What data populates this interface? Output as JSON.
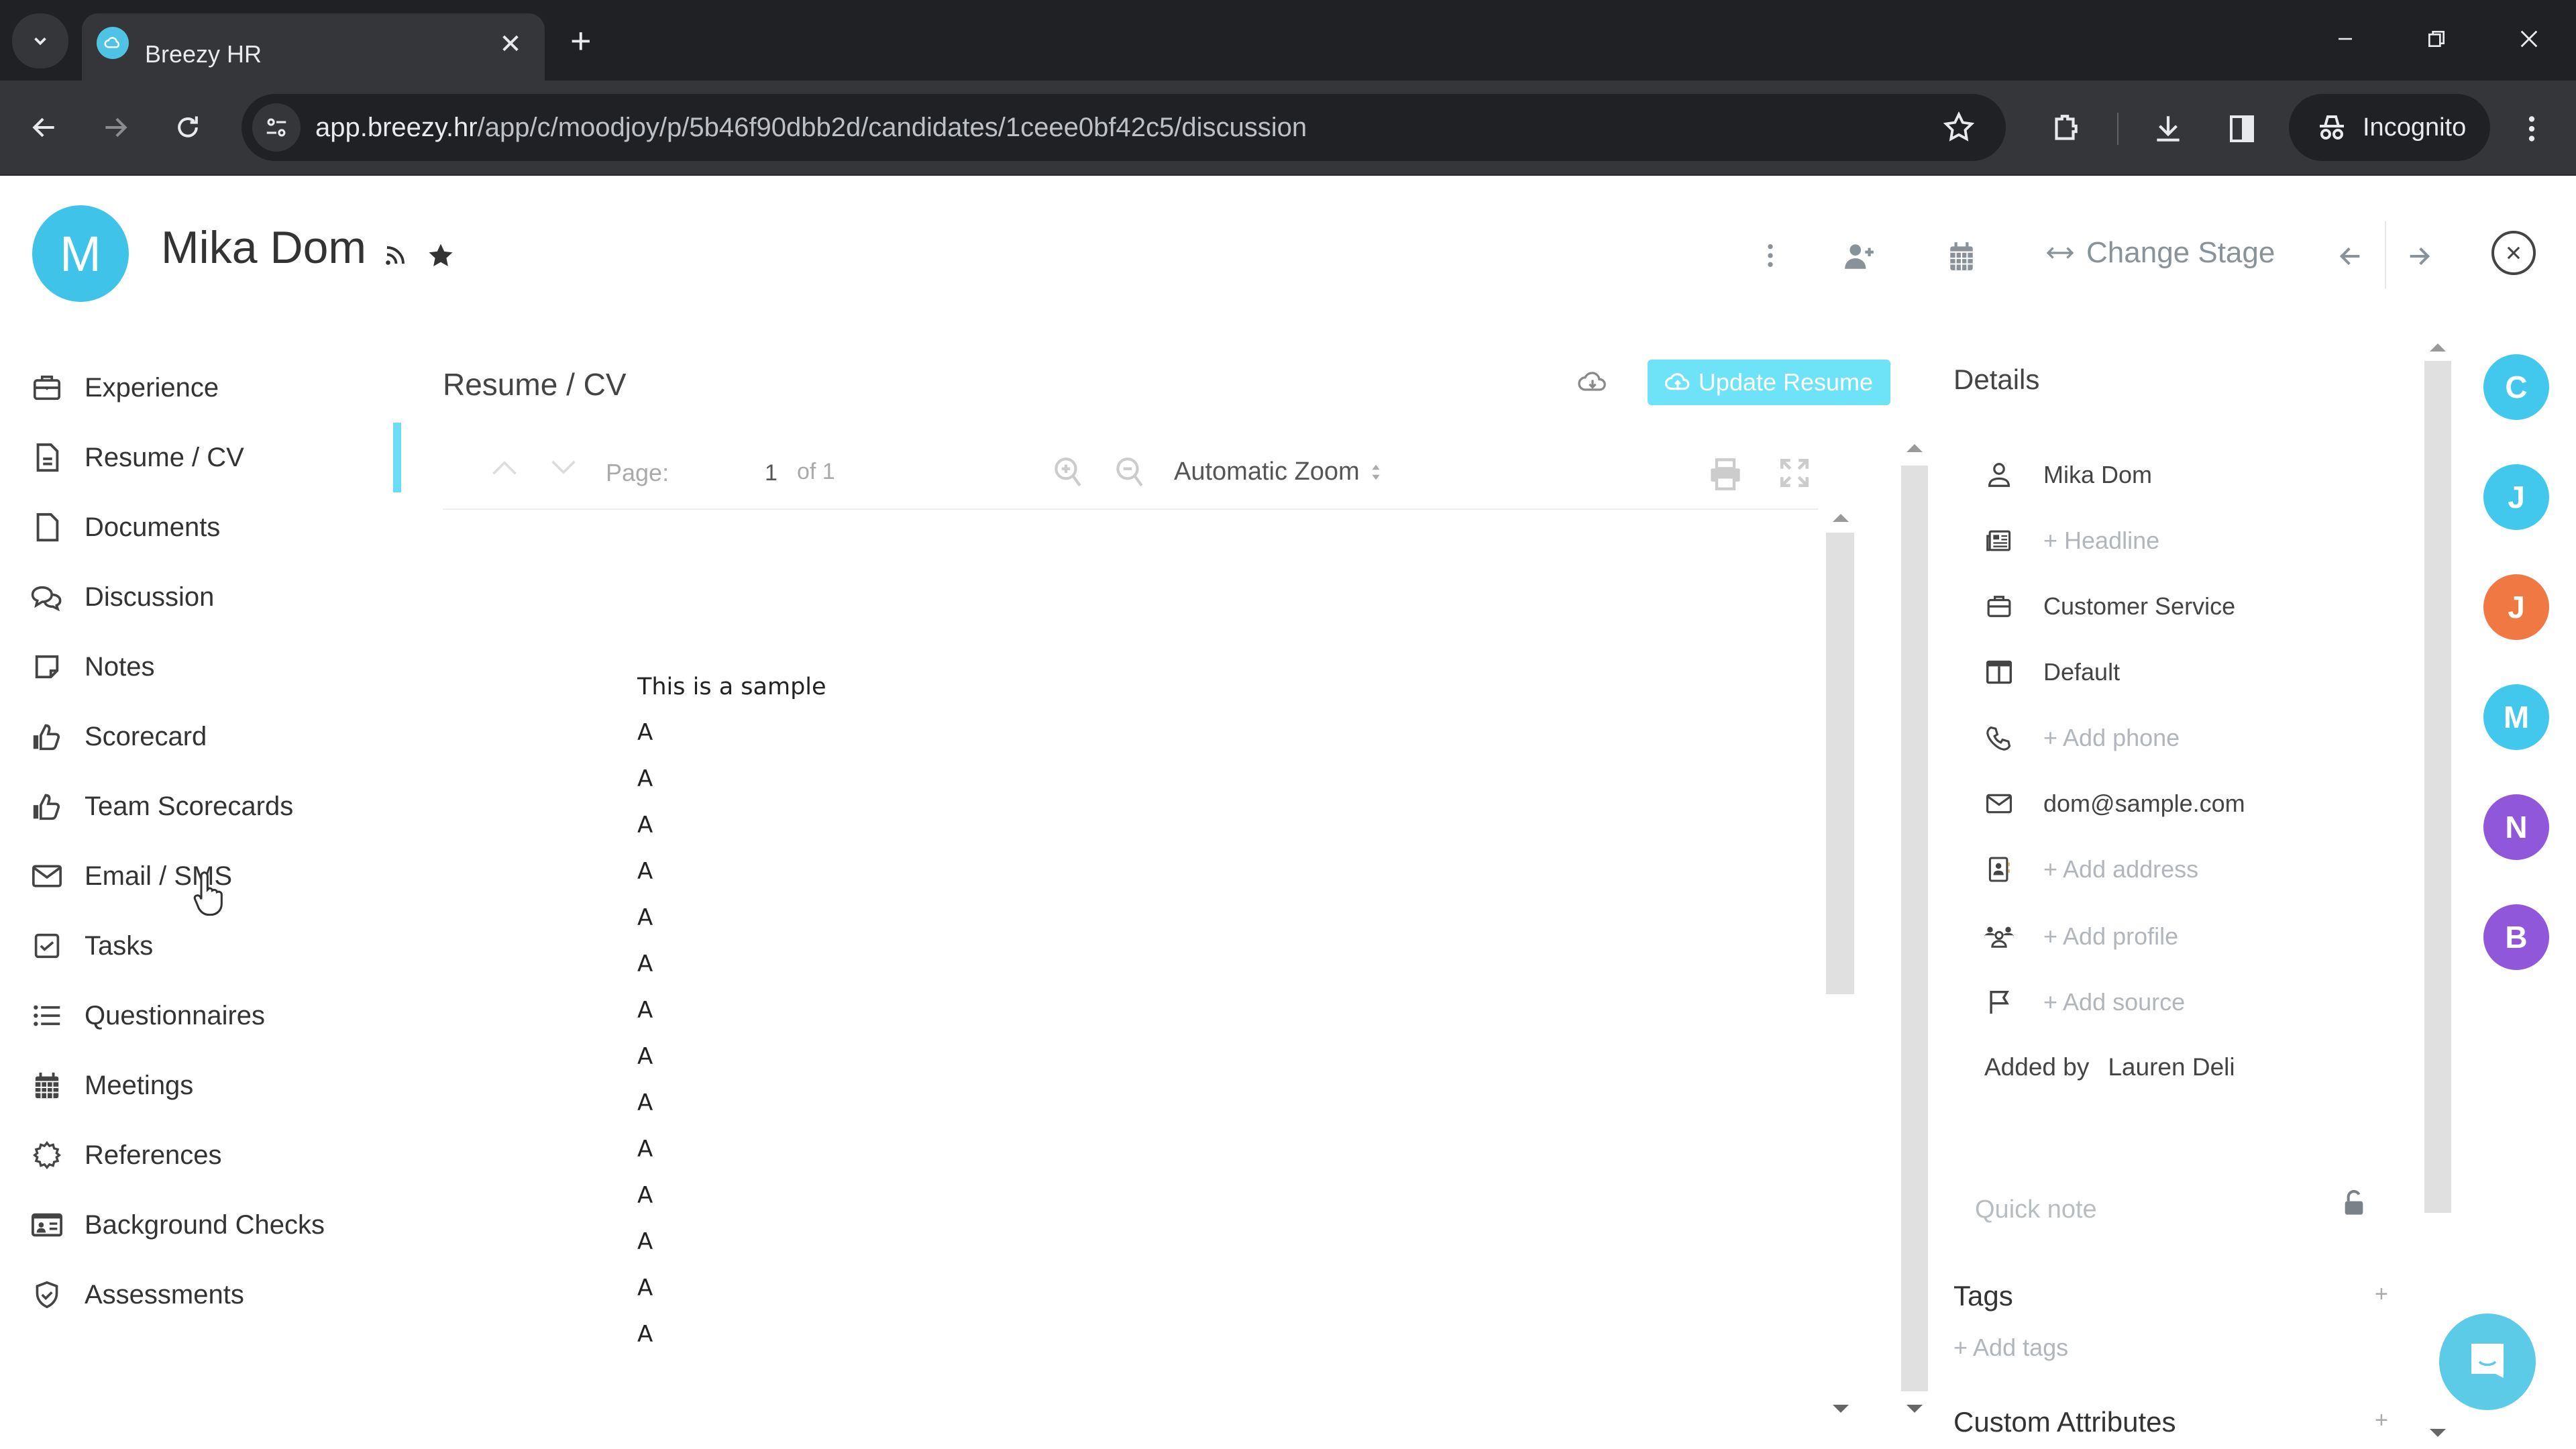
{
  "browser": {
    "tab_title": "Breezy HR",
    "url_host": "app.breezy.hr",
    "url_path": "/app/c/moodjoy/p/5b46f90dbb2d/candidates/1ceee0bf42c5/discussion",
    "incognito_label": "Incognito"
  },
  "header": {
    "avatar_initial": "M",
    "candidate_name": "Mika Dom",
    "change_stage_label": "Change Stage",
    "colors": {
      "avatar": "#3fc3e8"
    }
  },
  "sidebar": {
    "items": [
      {
        "label": "Experience",
        "icon": "briefcase-icon"
      },
      {
        "label": "Resume / CV",
        "icon": "document-icon",
        "active": true
      },
      {
        "label": "Documents",
        "icon": "file-icon"
      },
      {
        "label": "Discussion",
        "icon": "chat-bubbles-icon"
      },
      {
        "label": "Notes",
        "icon": "note-icon"
      },
      {
        "label": "Scorecard",
        "icon": "thumbs-up-icon"
      },
      {
        "label": "Team Scorecards",
        "icon": "thumbs-up-icon"
      },
      {
        "label": "Email / SMS",
        "icon": "envelope-icon"
      },
      {
        "label": "Tasks",
        "icon": "checkbox-icon"
      },
      {
        "label": "Questionnaires",
        "icon": "list-icon"
      },
      {
        "label": "Meetings",
        "icon": "calendar-icon"
      },
      {
        "label": "References",
        "icon": "badge-icon"
      },
      {
        "label": "Background Checks",
        "icon": "id-card-icon"
      },
      {
        "label": "Assessments",
        "icon": "shield-check-icon"
      }
    ]
  },
  "resume": {
    "title": "Resume / CV",
    "update_button": "Update Resume",
    "page_label": "Page:",
    "page_current": "1",
    "page_total_label": "of 1",
    "zoom_option": "Automatic Zoom",
    "document_lines": [
      "This is a sample",
      "A",
      "A",
      "A",
      "A",
      "A",
      "A",
      "A",
      "A",
      "A",
      "A",
      "A",
      "A",
      "A",
      "A"
    ]
  },
  "details": {
    "title": "Details",
    "rows": [
      {
        "icon": "person-icon",
        "value": "Mika Dom",
        "placeholder": false
      },
      {
        "icon": "headline-icon",
        "value": "+ Headline",
        "placeholder": true
      },
      {
        "icon": "briefcase-icon",
        "value": "Customer Service",
        "placeholder": false
      },
      {
        "icon": "pipeline-icon",
        "value": "Default",
        "placeholder": false
      },
      {
        "icon": "phone-icon",
        "value": "+ Add phone",
        "placeholder": true
      },
      {
        "icon": "envelope-icon",
        "value": "dom@sample.com",
        "placeholder": false
      },
      {
        "icon": "address-book-icon",
        "value": "+ Add address",
        "placeholder": true
      },
      {
        "icon": "people-icon",
        "value": "+ Add profile",
        "placeholder": true
      },
      {
        "icon": "flag-icon",
        "value": "+ Add source",
        "placeholder": true
      }
    ],
    "added_by_label": "Added by",
    "added_by_name": "Lauren Deli",
    "quick_note_placeholder": "Quick note",
    "tags_title": "Tags",
    "add_tags": "+ Add tags",
    "custom_attributes_title": "Custom Attributes"
  },
  "team_rail": [
    {
      "initial": "C",
      "color": "#42c8ec"
    },
    {
      "initial": "J",
      "color": "#42c8ec"
    },
    {
      "initial": "J",
      "color": "#f07843"
    },
    {
      "initial": "M",
      "color": "#42c8ec"
    },
    {
      "initial": "N",
      "color": "#9157db"
    },
    {
      "initial": "B",
      "color": "#9157db"
    }
  ],
  "colors": {
    "accent": "#6ee3f8",
    "active_indicator": "#6bdcf5",
    "chat_fab": "#5ccbe8"
  }
}
